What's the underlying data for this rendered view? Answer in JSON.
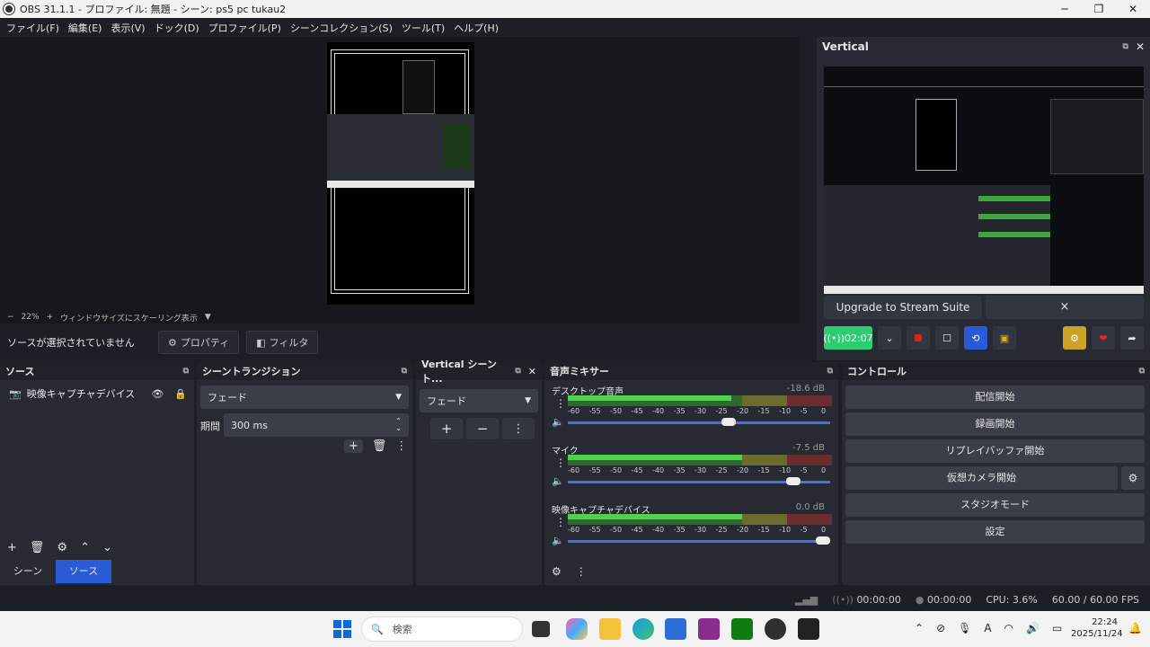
{
  "window": {
    "title": "OBS 31.1.1 - プロファイル: 無題 - シーン: ps5 pc tukau2"
  },
  "menu": [
    "ファイル(F)",
    "編集(E)",
    "表示(V)",
    "ドック(D)",
    "プロファイル(P)",
    "シーンコレクション(S)",
    "ツール(T)",
    "ヘルプ(H)"
  ],
  "preview": {
    "zoom_minus": "−",
    "zoom": "22%",
    "zoom_plus": "+",
    "scale_mode": "ウィンドウサイズにスケーリング表示"
  },
  "source_bar": {
    "no_source": "ソースが選択されていません",
    "properties": "プロパティ",
    "filters": "フィルタ"
  },
  "vertical": {
    "title": "Vertical",
    "upgrade": "Upgrade to Stream Suite",
    "close": "×",
    "timer": "02:07"
  },
  "sources": {
    "title": "ソース",
    "items": [
      {
        "name": "映像キャプチャデバイス"
      }
    ],
    "tab_scenes": "シーン",
    "tab_sources": "ソース"
  },
  "transitions": {
    "title": "シーントランジション",
    "type": "フェード",
    "duration_label": "期間",
    "duration": "300 ms"
  },
  "vscene": {
    "title": "Vertical シーント...",
    "type": "フェード"
  },
  "mixer": {
    "title": "音声ミキサー",
    "scale": [
      "-60",
      "-55",
      "-50",
      "-45",
      "-40",
      "-35",
      "-30",
      "-25",
      "-20",
      "-15",
      "-10",
      "-5",
      "0"
    ],
    "tracks": [
      {
        "name": "デスクトップ音声",
        "db": "-18.6 dB",
        "level": 0.62
      },
      {
        "name": "マイク",
        "db": "-7.5 dB",
        "level": 0.88
      },
      {
        "name": "映像キャプチャデバイス",
        "db": "0.0 dB",
        "level": 1.0
      }
    ]
  },
  "controls": {
    "title": "コントロール",
    "start_stream": "配信開始",
    "start_record": "録画開始",
    "replay_buffer": "リプレイバッファ開始",
    "virtual_cam": "仮想カメラ開始",
    "studio_mode": "スタジオモード",
    "settings": "設定"
  },
  "status": {
    "stream_time": "00:00:00",
    "rec_time": "00:00:00",
    "cpu": "CPU: 3.6%",
    "fps": "60.00 / 60.00 FPS"
  },
  "taskbar": {
    "search": "検索",
    "time": "22:24",
    "date": "2025/11/24",
    "ime": "A"
  },
  "colors": {
    "accent_blue": "#4b6ee0",
    "meter_green": "#3fa63f",
    "meter_yellow": "#a3a33b",
    "meter_red": "#a83a3a",
    "timer_green": "#2ecc71"
  }
}
